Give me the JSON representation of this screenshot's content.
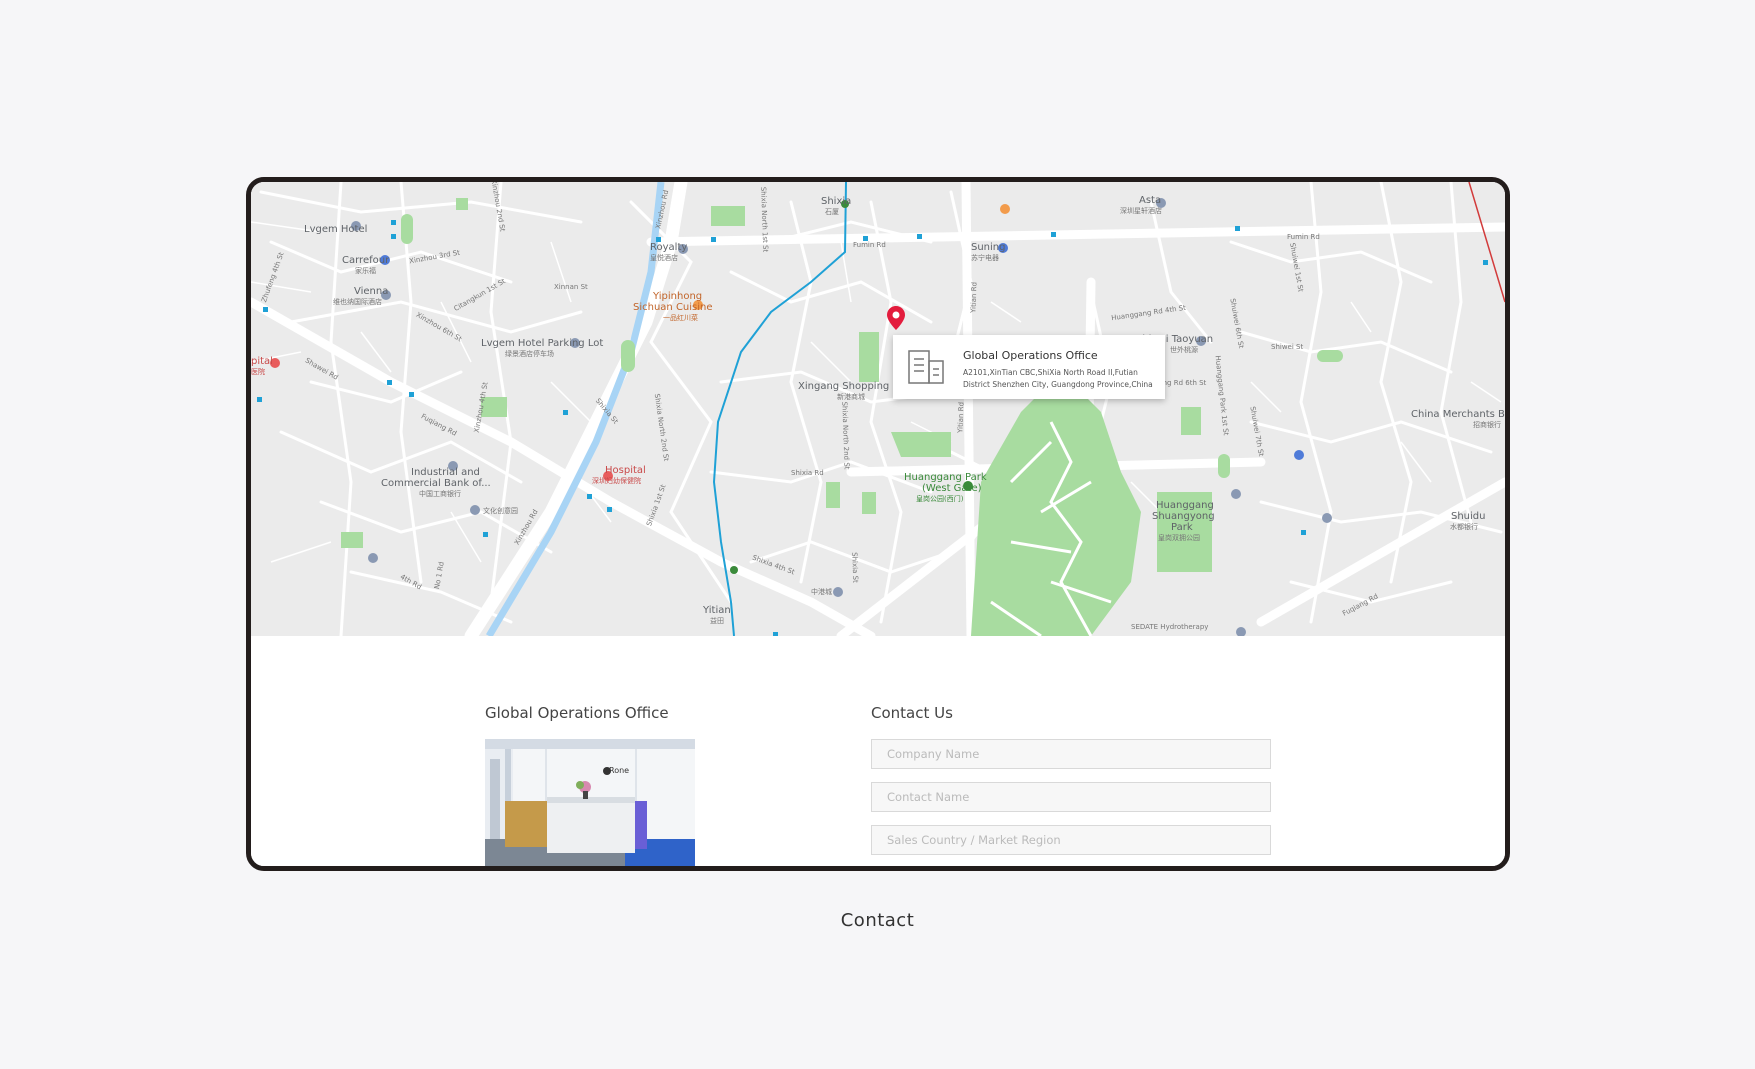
{
  "map": {
    "labels": {
      "lvgem_hotel": "Lvgem Hotel",
      "carrefour": "Carrefour",
      "carrefour_cn": "家乐福",
      "vienna": "Vienna",
      "vienna_cn": "维也纳国际酒店",
      "royalty": "Royalty",
      "royalty_cn": "皇悦酒店",
      "yipinhong": "Yipinhong",
      "sichuan": "Sichuan Cuisine",
      "sichuan_cn": "一品红川菜",
      "lvgem_parking": "Lvgem Hotel Parking Lot",
      "lvgem_parking_cn": "绿景酒店停车场",
      "hospital_left": "pital",
      "hospital_left_cn": "医院",
      "shixia": "Shixia",
      "shixia_cn": "石厦",
      "fumin_rd_1": "Fumin Rd",
      "fumin_rd_2": "Fumin Rd",
      "suning": "Suning",
      "suning_cn": "苏宁电器",
      "asta": "Asta",
      "asta_cn": "深圳星轩酒店",
      "xingang": "Xingang Shopping Mall",
      "xingang_cn": "新港商城",
      "shiwai": "Shiwai Taoyuan",
      "shiwai_cn": "世外桃源",
      "china_merchants": "China Merchants Bank",
      "china_merchants_cn": "招商银行",
      "industrial1": "Industrial and",
      "industrial2": "Commercial Bank of...",
      "industrial_cn": "中国工商银行",
      "culture": "文化创意园",
      "hospital": "Hospital",
      "hospital_cn": "深圳妇幼保健院",
      "huanggang_west": "Huanggang Park",
      "huanggang_west2": "(West Gate)",
      "huanggang_west_cn": "皇岗公园(西门)",
      "huanggang_park1": "Huanggang",
      "huanggang_park2": "Shuangyong",
      "huanggang_park3": "Park",
      "huanggang_park_cn": "皇岗双拥公园",
      "shuidu": "Shuidu",
      "shuidu_cn": "水都银行",
      "yitian": "Yitian",
      "yitian_cn": "益田",
      "zhonggang": "中港城",
      "sedate": "SEDATE Hydrotherapy",
      "fuqiang_rd_1": "Fuqiang Rd",
      "fuqiang_rd_2": "Fuqiang Rd",
      "xinzhou_rd_1": "Xinzhou Rd",
      "xinzhou_rd_2": "Xinzhou Rd",
      "yitian_rd": "Yitian Rd",
      "shixia_rd": "Shixia Rd",
      "shixia_n2": "Shixia North 2nd St",
      "shixia_n1": "Shixia North 1st St",
      "huanggang_4th": "Huanggang Rd 4th St",
      "huanggang_6th": "Huanggang Rd 6th St",
      "shiwei_st": "Shiwei St",
      "shuiwei_6th": "Shuiwei 6th St",
      "shuiwei_7th": "Shuiwei 7th St",
      "shuiwei_st": "Shuiwei 1st St",
      "huanggang_park_st": "Huanggang Park 1st St",
      "xinnan": "Xinnan St",
      "xinzhou_3rd": "Xinzhou 3rd St",
      "citangkun": "Citangkun 1st St",
      "xinzhou_6th": "Xinzhou 6th St",
      "shawei": "Shawei Rd",
      "xinzhou_4th": "Xinzhou 4th St",
      "shixia_st": "Shixia St",
      "shixia_1st": "Shixia 1st St",
      "xinzhou_2nd": "Xinzhou 2nd St",
      "no1": "No 1 Rd",
      "fourth": "4th Rd",
      "shixia_4th": "Shixia 4th St",
      "zhufeng": "Zhufeng 4th St",
      "shixia_north_2": "Shixia North 2nd St",
      "shixia_st_2": "Shixia St"
    },
    "popup": {
      "title": "Global Operations Office",
      "address": "A2101,XinTian CBC,ShiXia North Road II,Futian District Shenzhen City, Guangdong Province,China"
    },
    "colors": {
      "pin": "#e31c3d",
      "metro": "#1fa1d6",
      "park": "#a8dca0"
    }
  },
  "office": {
    "title": "Global Operations Office",
    "photo_logo": "Rone"
  },
  "contact": {
    "title": "Contact Us",
    "fields": {
      "company": "Company Name",
      "contact": "Contact Name",
      "region": "Sales Country / Market Region"
    }
  },
  "caption": "Contact"
}
